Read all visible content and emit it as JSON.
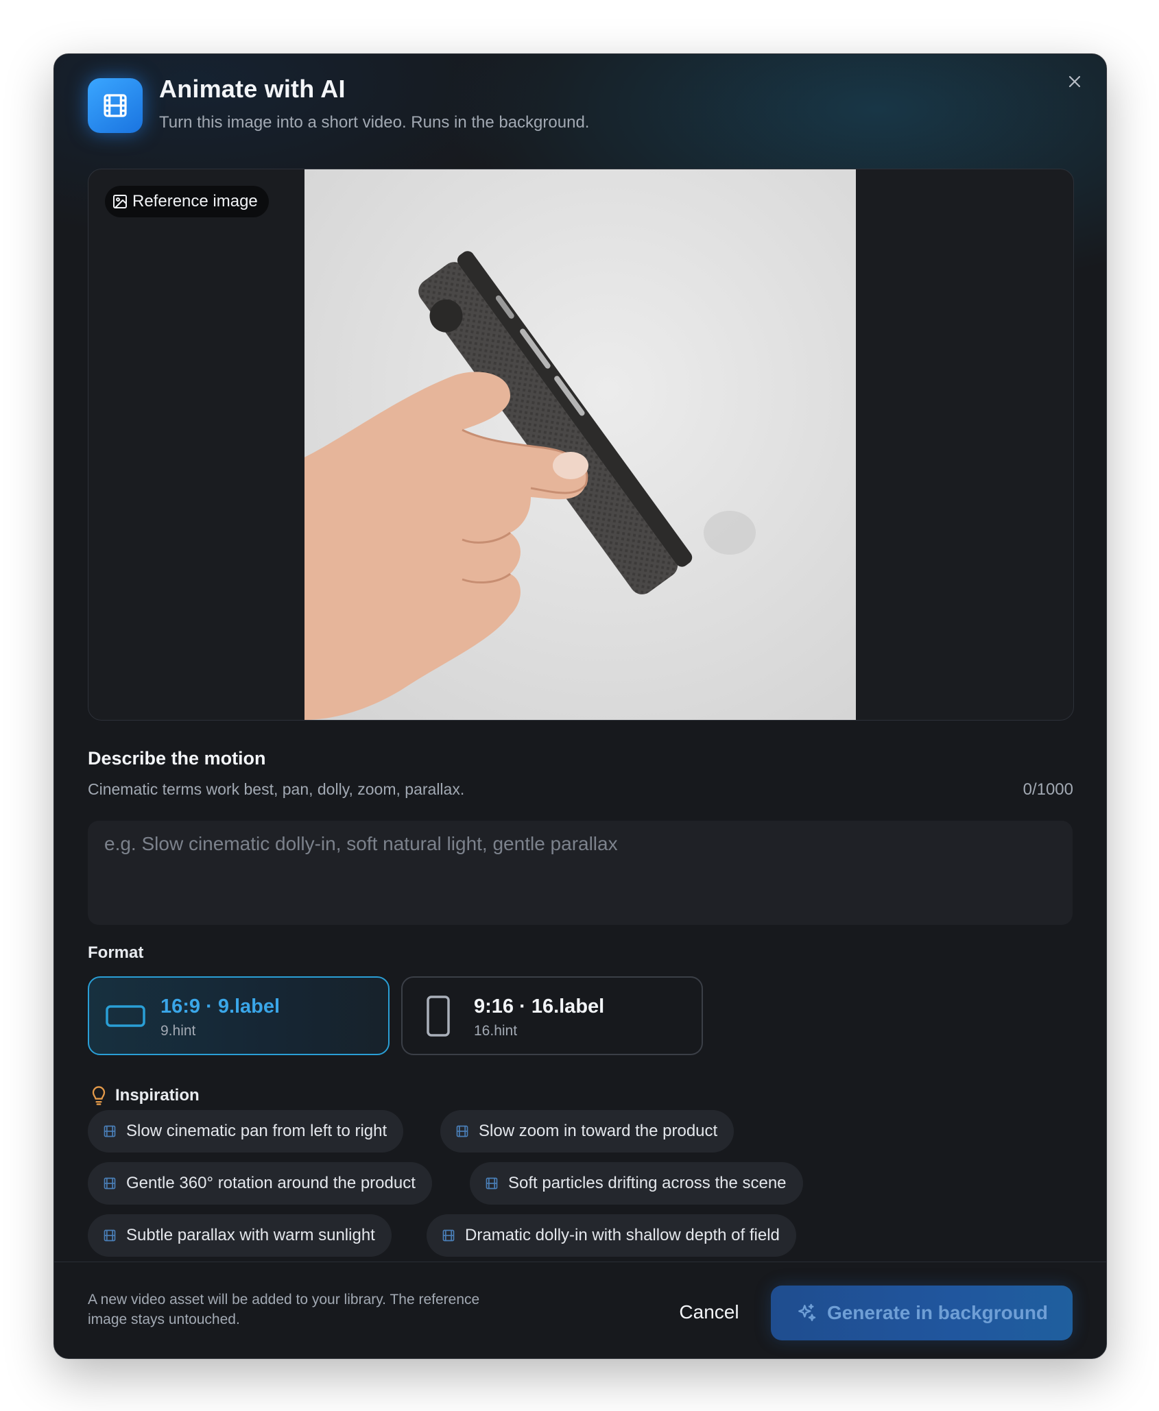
{
  "header": {
    "title": "Animate with AI",
    "subtitle": "Turn this image into a short video. Runs in the background.",
    "app_icon": "film-icon",
    "close_icon": "close-icon"
  },
  "preview": {
    "badge_label": "Reference image",
    "badge_icon": "image-icon"
  },
  "motion": {
    "title": "Describe the motion",
    "subtitle": "Cinematic terms work best, pan, dolly, zoom, parallax.",
    "counter": "0/1000",
    "value": "",
    "placeholder": "e.g. Slow cinematic dolly-in, soft natural light, gentle parallax"
  },
  "format": {
    "label": "Format",
    "options": [
      {
        "name": "16:9 · 9.label",
        "hint": "9.hint",
        "selected": true,
        "icon": "landscape-frame-icon"
      },
      {
        "name": "9:16 · 16.label",
        "hint": "16.hint",
        "selected": false,
        "icon": "portrait-frame-icon"
      }
    ]
  },
  "inspiration": {
    "label": "Inspiration",
    "icon": "lightbulb-icon",
    "chips": [
      "Slow cinematic pan from left to right",
      "Slow zoom in toward the product",
      "Gentle 360° rotation around the product",
      "Soft particles drifting across the scene",
      "Subtle parallax with warm sunlight",
      "Dramatic dolly-in with shallow depth of field"
    ]
  },
  "footer": {
    "note": "A new video asset will be added to your library. The reference image stays untouched.",
    "cancel_label": "Cancel",
    "generate_label": "Generate in background",
    "generate_icon": "sparkles-icon"
  },
  "colors": {
    "accent": "#2a9fd6",
    "accent_text": "#3aa6e8",
    "modal_bg": "#17191d",
    "button_bg": "#20569e"
  }
}
